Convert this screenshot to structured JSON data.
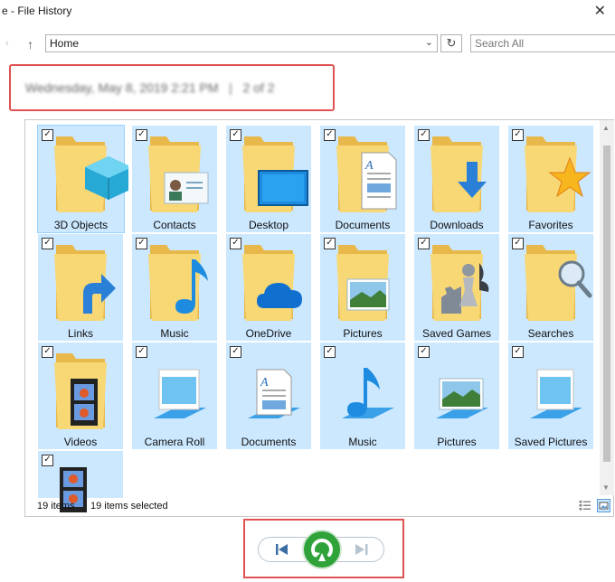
{
  "window": {
    "title": "e - File History",
    "close_glyph": "✕"
  },
  "toolbar": {
    "address": "Home",
    "search_placeholder": "Search All"
  },
  "snapshot": {
    "date": "Wednesday, May 8, 2019 2:21 PM",
    "separator": "|",
    "position": "2 of 2"
  },
  "items": [
    {
      "label": "3D Objects",
      "icon": "3d-objects-folder-icon",
      "selected": true
    },
    {
      "label": "Contacts",
      "icon": "contacts-folder-icon"
    },
    {
      "label": "Desktop",
      "icon": "desktop-folder-icon"
    },
    {
      "label": "Documents",
      "icon": "documents-folder-icon"
    },
    {
      "label": "Downloads",
      "icon": "downloads-folder-icon"
    },
    {
      "label": "Favorites",
      "icon": "favorites-folder-icon"
    },
    {
      "label": "Links",
      "icon": "links-folder-icon"
    },
    {
      "label": "Music",
      "icon": "music-folder-icon"
    },
    {
      "label": "OneDrive",
      "icon": "onedrive-folder-icon"
    },
    {
      "label": "Pictures",
      "icon": "pictures-folder-icon"
    },
    {
      "label": "Saved Games",
      "icon": "saved-games-folder-icon"
    },
    {
      "label": "Searches",
      "icon": "searches-folder-icon"
    },
    {
      "label": "Videos",
      "icon": "videos-folder-icon"
    },
    {
      "label": "Camera Roll",
      "icon": "camera-roll-library-icon"
    },
    {
      "label": "Documents",
      "icon": "documents-library-icon"
    },
    {
      "label": "Music",
      "icon": "music-library-icon"
    },
    {
      "label": "Pictures",
      "icon": "pictures-library-icon"
    },
    {
      "label": "Saved Pictures",
      "icon": "saved-pictures-library-icon"
    },
    {
      "label": "",
      "icon": "videos-library-icon"
    }
  ],
  "status": {
    "count": "19 items",
    "selected": "19 items selected"
  },
  "colors": {
    "selection": "#cce8ff",
    "folder": "#f8d775",
    "accent": "#2fa33a",
    "highlight_box": "#e05252"
  }
}
